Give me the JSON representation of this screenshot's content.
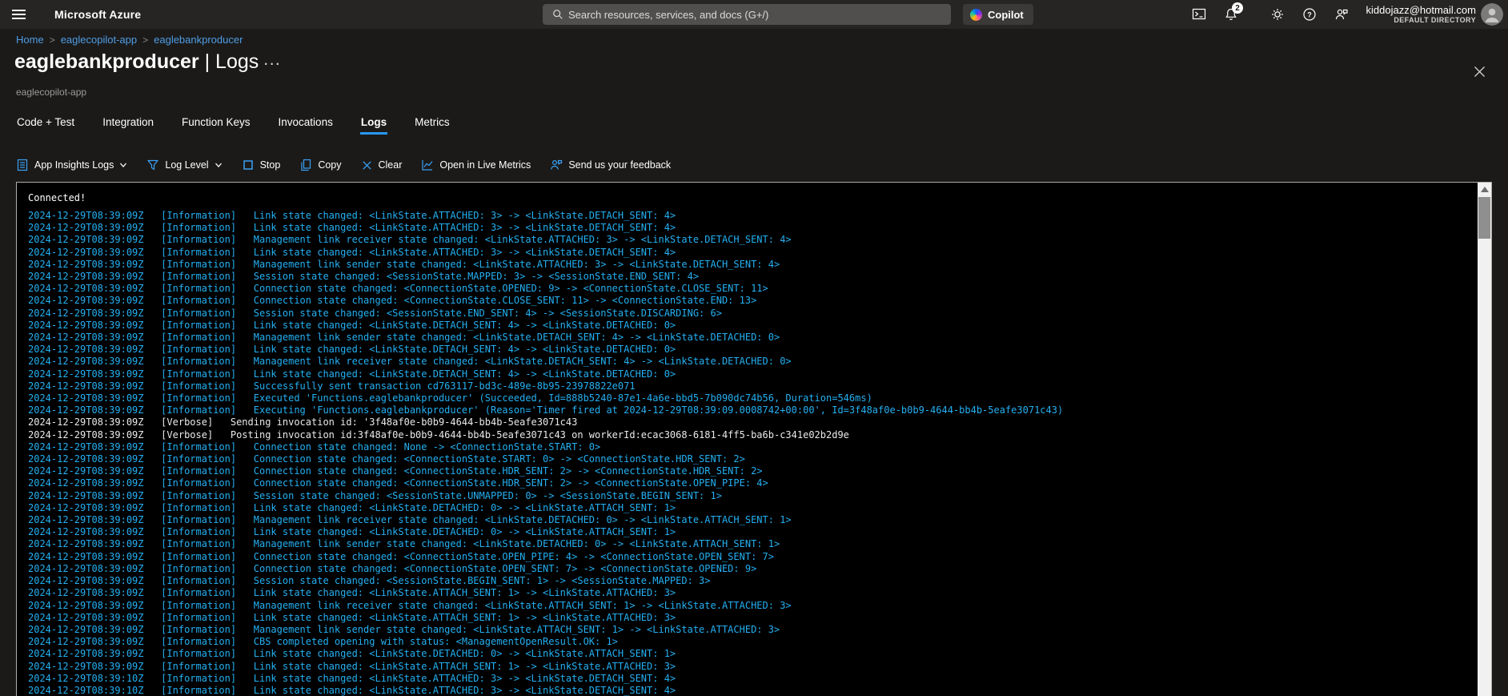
{
  "colors": {
    "accent": "#2899f5",
    "toolbar_icon_blue": "#3aa0f4",
    "log_info": "#24b0f2",
    "log_verbose": "#eaeaea",
    "console_bg": "#000000",
    "topbar_bg": "#262524",
    "page_bg": "#1b1a19"
  },
  "topbar": {
    "brand": "Microsoft Azure",
    "search_placeholder": "Search resources, services, and docs (G+/)",
    "copilot_label": "Copilot",
    "notification_count": "2",
    "account": {
      "email": "kiddojazz@hotmail.com",
      "directory": "DEFAULT DIRECTORY"
    }
  },
  "breadcrumb": {
    "items": [
      "Home",
      "eaglecopilot-app",
      "eaglebankproducer"
    ]
  },
  "header": {
    "title": "eaglebankproducer",
    "title_suffix": "| Logs",
    "subtitle": "eaglecopilot-app"
  },
  "tabs": [
    {
      "label": "Code + Test",
      "active": false
    },
    {
      "label": "Integration",
      "active": false
    },
    {
      "label": "Function Keys",
      "active": false
    },
    {
      "label": "Invocations",
      "active": false
    },
    {
      "label": "Logs",
      "active": true
    },
    {
      "label": "Metrics",
      "active": false
    }
  ],
  "toolbar": {
    "items": [
      {
        "name": "app-insights-logs",
        "label": "App Insights Logs",
        "icon": "logs-list",
        "dropdown": true
      },
      {
        "name": "log-level",
        "label": "Log Level",
        "icon": "filter",
        "dropdown": true
      },
      {
        "name": "stop",
        "label": "Stop",
        "icon": "stop",
        "dropdown": false
      },
      {
        "name": "copy",
        "label": "Copy",
        "icon": "copy",
        "dropdown": false
      },
      {
        "name": "clear",
        "label": "Clear",
        "icon": "clear-x",
        "dropdown": false
      },
      {
        "name": "open-live-metrics",
        "label": "Open in Live Metrics",
        "icon": "line-chart",
        "dropdown": false
      },
      {
        "name": "send-feedback",
        "label": "Send us your feedback",
        "icon": "person-feedback",
        "dropdown": false
      }
    ]
  },
  "console": {
    "connected_text": "Connected!",
    "lines": [
      {
        "ts": "2024-12-29T08:39:09Z",
        "level": "Information",
        "msg": "Link state changed: <LinkState.ATTACHED: 3> -> <LinkState.DETACH_SENT: 4>"
      },
      {
        "ts": "2024-12-29T08:39:09Z",
        "level": "Information",
        "msg": "Link state changed: <LinkState.ATTACHED: 3> -> <LinkState.DETACH_SENT: 4>"
      },
      {
        "ts": "2024-12-29T08:39:09Z",
        "level": "Information",
        "msg": "Management link receiver state changed: <LinkState.ATTACHED: 3> -> <LinkState.DETACH_SENT: 4>"
      },
      {
        "ts": "2024-12-29T08:39:09Z",
        "level": "Information",
        "msg": "Link state changed: <LinkState.ATTACHED: 3> -> <LinkState.DETACH_SENT: 4>"
      },
      {
        "ts": "2024-12-29T08:39:09Z",
        "level": "Information",
        "msg": "Management link sender state changed: <LinkState.ATTACHED: 3> -> <LinkState.DETACH_SENT: 4>"
      },
      {
        "ts": "2024-12-29T08:39:09Z",
        "level": "Information",
        "msg": "Session state changed: <SessionState.MAPPED: 3> -> <SessionState.END_SENT: 4>"
      },
      {
        "ts": "2024-12-29T08:39:09Z",
        "level": "Information",
        "msg": "Connection state changed: <ConnectionState.OPENED: 9> -> <ConnectionState.CLOSE_SENT: 11>"
      },
      {
        "ts": "2024-12-29T08:39:09Z",
        "level": "Information",
        "msg": "Connection state changed: <ConnectionState.CLOSE_SENT: 11> -> <ConnectionState.END: 13>"
      },
      {
        "ts": "2024-12-29T08:39:09Z",
        "level": "Information",
        "msg": "Session state changed: <SessionState.END_SENT: 4> -> <SessionState.DISCARDING: 6>"
      },
      {
        "ts": "2024-12-29T08:39:09Z",
        "level": "Information",
        "msg": "Link state changed: <LinkState.DETACH_SENT: 4> -> <LinkState.DETACHED: 0>"
      },
      {
        "ts": "2024-12-29T08:39:09Z",
        "level": "Information",
        "msg": "Management link sender state changed: <LinkState.DETACH_SENT: 4> -> <LinkState.DETACHED: 0>"
      },
      {
        "ts": "2024-12-29T08:39:09Z",
        "level": "Information",
        "msg": "Link state changed: <LinkState.DETACH_SENT: 4> -> <LinkState.DETACHED: 0>"
      },
      {
        "ts": "2024-12-29T08:39:09Z",
        "level": "Information",
        "msg": "Management link receiver state changed: <LinkState.DETACH_SENT: 4> -> <LinkState.DETACHED: 0>"
      },
      {
        "ts": "2024-12-29T08:39:09Z",
        "level": "Information",
        "msg": "Link state changed: <LinkState.DETACH_SENT: 4> -> <LinkState.DETACHED: 0>"
      },
      {
        "ts": "2024-12-29T08:39:09Z",
        "level": "Information",
        "msg": "Successfully sent transaction cd763117-bd3c-489e-8b95-23978822e071"
      },
      {
        "ts": "2024-12-29T08:39:09Z",
        "level": "Information",
        "msg": "Executed 'Functions.eaglebankproducer' (Succeeded, Id=888b5240-87e1-4a6e-bbd5-7b090dc74b56, Duration=546ms)"
      },
      {
        "ts": "2024-12-29T08:39:09Z",
        "level": "Information",
        "msg": "Executing 'Functions.eaglebankproducer' (Reason='Timer fired at 2024-12-29T08:39:09.0008742+00:00', Id=3f48af0e-b0b9-4644-bb4b-5eafe3071c43)"
      },
      {
        "ts": "2024-12-29T08:39:09Z",
        "level": "Verbose",
        "msg": "Sending invocation id: '3f48af0e-b0b9-4644-bb4b-5eafe3071c43"
      },
      {
        "ts": "2024-12-29T08:39:09Z",
        "level": "Verbose",
        "msg": "Posting invocation id:3f48af0e-b0b9-4644-bb4b-5eafe3071c43 on workerId:ecac3068-6181-4ff5-ba6b-c341e02b2d9e"
      },
      {
        "ts": "2024-12-29T08:39:09Z",
        "level": "Information",
        "msg": "Connection state changed: None -> <ConnectionState.START: 0>"
      },
      {
        "ts": "2024-12-29T08:39:09Z",
        "level": "Information",
        "msg": "Connection state changed: <ConnectionState.START: 0> -> <ConnectionState.HDR_SENT: 2>"
      },
      {
        "ts": "2024-12-29T08:39:09Z",
        "level": "Information",
        "msg": "Connection state changed: <ConnectionState.HDR_SENT: 2> -> <ConnectionState.HDR_SENT: 2>"
      },
      {
        "ts": "2024-12-29T08:39:09Z",
        "level": "Information",
        "msg": "Connection state changed: <ConnectionState.HDR_SENT: 2> -> <ConnectionState.OPEN_PIPE: 4>"
      },
      {
        "ts": "2024-12-29T08:39:09Z",
        "level": "Information",
        "msg": "Session state changed: <SessionState.UNMAPPED: 0> -> <SessionState.BEGIN_SENT: 1>"
      },
      {
        "ts": "2024-12-29T08:39:09Z",
        "level": "Information",
        "msg": "Link state changed: <LinkState.DETACHED: 0> -> <LinkState.ATTACH_SENT: 1>"
      },
      {
        "ts": "2024-12-29T08:39:09Z",
        "level": "Information",
        "msg": "Management link receiver state changed: <LinkState.DETACHED: 0> -> <LinkState.ATTACH_SENT: 1>"
      },
      {
        "ts": "2024-12-29T08:39:09Z",
        "level": "Information",
        "msg": "Link state changed: <LinkState.DETACHED: 0> -> <LinkState.ATTACH_SENT: 1>"
      },
      {
        "ts": "2024-12-29T08:39:09Z",
        "level": "Information",
        "msg": "Management link sender state changed: <LinkState.DETACHED: 0> -> <LinkState.ATTACH_SENT: 1>"
      },
      {
        "ts": "2024-12-29T08:39:09Z",
        "level": "Information",
        "msg": "Connection state changed: <ConnectionState.OPEN_PIPE: 4> -> <ConnectionState.OPEN_SENT: 7>"
      },
      {
        "ts": "2024-12-29T08:39:09Z",
        "level": "Information",
        "msg": "Connection state changed: <ConnectionState.OPEN_SENT: 7> -> <ConnectionState.OPENED: 9>"
      },
      {
        "ts": "2024-12-29T08:39:09Z",
        "level": "Information",
        "msg": "Session state changed: <SessionState.BEGIN_SENT: 1> -> <SessionState.MAPPED: 3>"
      },
      {
        "ts": "2024-12-29T08:39:09Z",
        "level": "Information",
        "msg": "Link state changed: <LinkState.ATTACH_SENT: 1> -> <LinkState.ATTACHED: 3>"
      },
      {
        "ts": "2024-12-29T08:39:09Z",
        "level": "Information",
        "msg": "Management link receiver state changed: <LinkState.ATTACH_SENT: 1> -> <LinkState.ATTACHED: 3>"
      },
      {
        "ts": "2024-12-29T08:39:09Z",
        "level": "Information",
        "msg": "Link state changed: <LinkState.ATTACH_SENT: 1> -> <LinkState.ATTACHED: 3>"
      },
      {
        "ts": "2024-12-29T08:39:09Z",
        "level": "Information",
        "msg": "Management link sender state changed: <LinkState.ATTACH_SENT: 1> -> <LinkState.ATTACHED: 3>"
      },
      {
        "ts": "2024-12-29T08:39:09Z",
        "level": "Information",
        "msg": "CBS completed opening with status: <ManagementOpenResult.OK: 1>"
      },
      {
        "ts": "2024-12-29T08:39:09Z",
        "level": "Information",
        "msg": "Link state changed: <LinkState.DETACHED: 0> -> <LinkState.ATTACH_SENT: 1>"
      },
      {
        "ts": "2024-12-29T08:39:09Z",
        "level": "Information",
        "msg": "Link state changed: <LinkState.ATTACH_SENT: 1> -> <LinkState.ATTACHED: 3>"
      },
      {
        "ts": "2024-12-29T08:39:10Z",
        "level": "Information",
        "msg": "Link state changed: <LinkState.ATTACHED: 3> -> <LinkState.DETACH_SENT: 4>"
      },
      {
        "ts": "2024-12-29T08:39:10Z",
        "level": "Information",
        "msg": "Link state changed: <LinkState.ATTACHED: 3> -> <LinkState.DETACH_SENT: 4>"
      }
    ]
  }
}
